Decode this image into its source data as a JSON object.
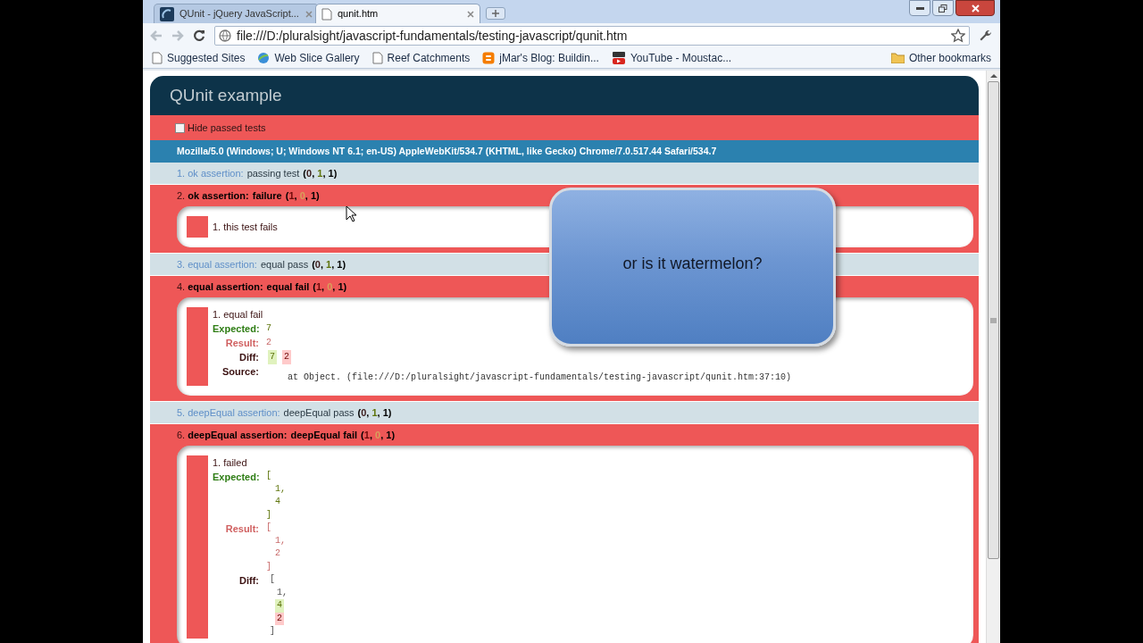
{
  "browser": {
    "tabs": [
      {
        "title": "QUnit - jQuery JavaScript...",
        "selected": false
      },
      {
        "title": "qunit.htm",
        "selected": true
      }
    ],
    "url": "file:///D:/pluralsight/javascript-fundamentals/testing-javascript/qunit.htm",
    "bookmarks": [
      {
        "label": "Suggested Sites",
        "kind": "page"
      },
      {
        "label": "Web Slice Gallery",
        "kind": "globe"
      },
      {
        "label": "Reef Catchments",
        "kind": "page"
      },
      {
        "label": "jMar's Blog: Buildin...",
        "kind": "blog"
      },
      {
        "label": "YouTube - Moustac...",
        "kind": "video"
      }
    ],
    "other_bookmarks": "Other bookmarks"
  },
  "qunit": {
    "title": "QUnit example",
    "hide_passed": {
      "label": "Hide passed tests",
      "checked": false
    },
    "user_agent": "Mozilla/5.0 (Windows; U; Windows NT 6.1; en-US) AppleWebKit/534.7 (KHTML, like Gecko) Chrome/7.0.517.44 Safari/534.7",
    "tests": [
      {
        "number": "1.",
        "module": "ok assertion:",
        "name": "passing test",
        "passed": true,
        "counts": [
          {
            "text": "(",
            "kind": "punct"
          },
          {
            "text": "0",
            "kind": "failed"
          },
          {
            "text": ", ",
            "kind": "punct"
          },
          {
            "text": "1",
            "kind": "passed"
          },
          {
            "text": ", ",
            "kind": "punct"
          },
          {
            "text": "1",
            "kind": "total"
          },
          {
            "text": ")",
            "kind": "punct"
          }
        ]
      },
      {
        "number": "2.",
        "module": "ok assertion:",
        "name": "failure",
        "passed": false,
        "counts": [
          {
            "text": "(",
            "kind": "punct"
          },
          {
            "text": "1",
            "kind": "failed"
          },
          {
            "text": ", ",
            "kind": "punct"
          },
          {
            "text": "0",
            "kind": "passed"
          },
          {
            "text": ", ",
            "kind": "punct"
          },
          {
            "text": "1",
            "kind": "total"
          },
          {
            "text": ")",
            "kind": "punct"
          }
        ],
        "assertions": [
          {
            "message": "1. this test fails"
          }
        ]
      },
      {
        "number": "3.",
        "module": "equal assertion:",
        "name": "equal pass",
        "passed": true,
        "counts": [
          {
            "text": "(",
            "kind": "punct"
          },
          {
            "text": "0",
            "kind": "failed"
          },
          {
            "text": ", ",
            "kind": "punct"
          },
          {
            "text": "1",
            "kind": "passed"
          },
          {
            "text": ", ",
            "kind": "punct"
          },
          {
            "text": "1",
            "kind": "total"
          },
          {
            "text": ")",
            "kind": "punct"
          }
        ]
      },
      {
        "number": "4.",
        "module": "equal assertion:",
        "name": "equal fail",
        "passed": false,
        "counts": [
          {
            "text": "(",
            "kind": "punct"
          },
          {
            "text": "1",
            "kind": "failed"
          },
          {
            "text": ", ",
            "kind": "punct"
          },
          {
            "text": "0",
            "kind": "passed"
          },
          {
            "text": ", ",
            "kind": "punct"
          },
          {
            "text": "1",
            "kind": "total"
          },
          {
            "text": ")",
            "kind": "punct"
          }
        ],
        "assertions": [
          {
            "message": "1. equal fail",
            "expected_label": "Expected:",
            "expected": [
              "7"
            ],
            "result_label": "Result:",
            "result": [
              "2"
            ],
            "diff_label": "Diff:",
            "diff": [
              [
                {
                  "text": "7",
                  "kind": "ins"
                },
                {
                  "text": "2",
                  "kind": "del"
                }
              ]
            ],
            "source_label": "Source:",
            "source": "at Object. (file:///D:/pluralsight/javascript-fundamentals/testing-javascript/qunit.htm:37:10)"
          }
        ]
      },
      {
        "number": "5.",
        "module": "deepEqual assertion:",
        "name": "deepEqual pass",
        "passed": true,
        "counts": [
          {
            "text": "(",
            "kind": "punct"
          },
          {
            "text": "0",
            "kind": "failed"
          },
          {
            "text": ", ",
            "kind": "punct"
          },
          {
            "text": "1",
            "kind": "passed"
          },
          {
            "text": ", ",
            "kind": "punct"
          },
          {
            "text": "1",
            "kind": "total"
          },
          {
            "text": ")",
            "kind": "punct"
          }
        ]
      },
      {
        "number": "6.",
        "module": "deepEqual assertion:",
        "name": "deepEqual fail",
        "passed": false,
        "counts": [
          {
            "text": "(",
            "kind": "punct"
          },
          {
            "text": "1",
            "kind": "failed"
          },
          {
            "text": ", ",
            "kind": "punct"
          },
          {
            "text": "0",
            "kind": "passed"
          },
          {
            "text": ", ",
            "kind": "punct"
          },
          {
            "text": "1",
            "kind": "total"
          },
          {
            "text": ")",
            "kind": "punct"
          }
        ],
        "assertions": [
          {
            "message": "1. failed",
            "expected_label": "Expected:",
            "expected": [
              "[",
              "1,",
              "4",
              "]"
            ],
            "result_label": "Result:",
            "result": [
              "[",
              "1,",
              "2",
              "]"
            ],
            "diff_label": "Diff:",
            "diff": [
              [
                {
                  "text": "[",
                  "kind": "same"
                }
              ],
              [
                {
                  "text": "1,",
                  "kind": "same"
                }
              ],
              [
                {
                  "text": "4",
                  "kind": "ins"
                }
              ],
              [
                {
                  "text": "2",
                  "kind": "del"
                }
              ],
              [
                {
                  "text": "]",
                  "kind": "same"
                }
              ]
            ]
          }
        ]
      }
    ]
  },
  "callout": {
    "text": "or is it watermelon?"
  }
}
